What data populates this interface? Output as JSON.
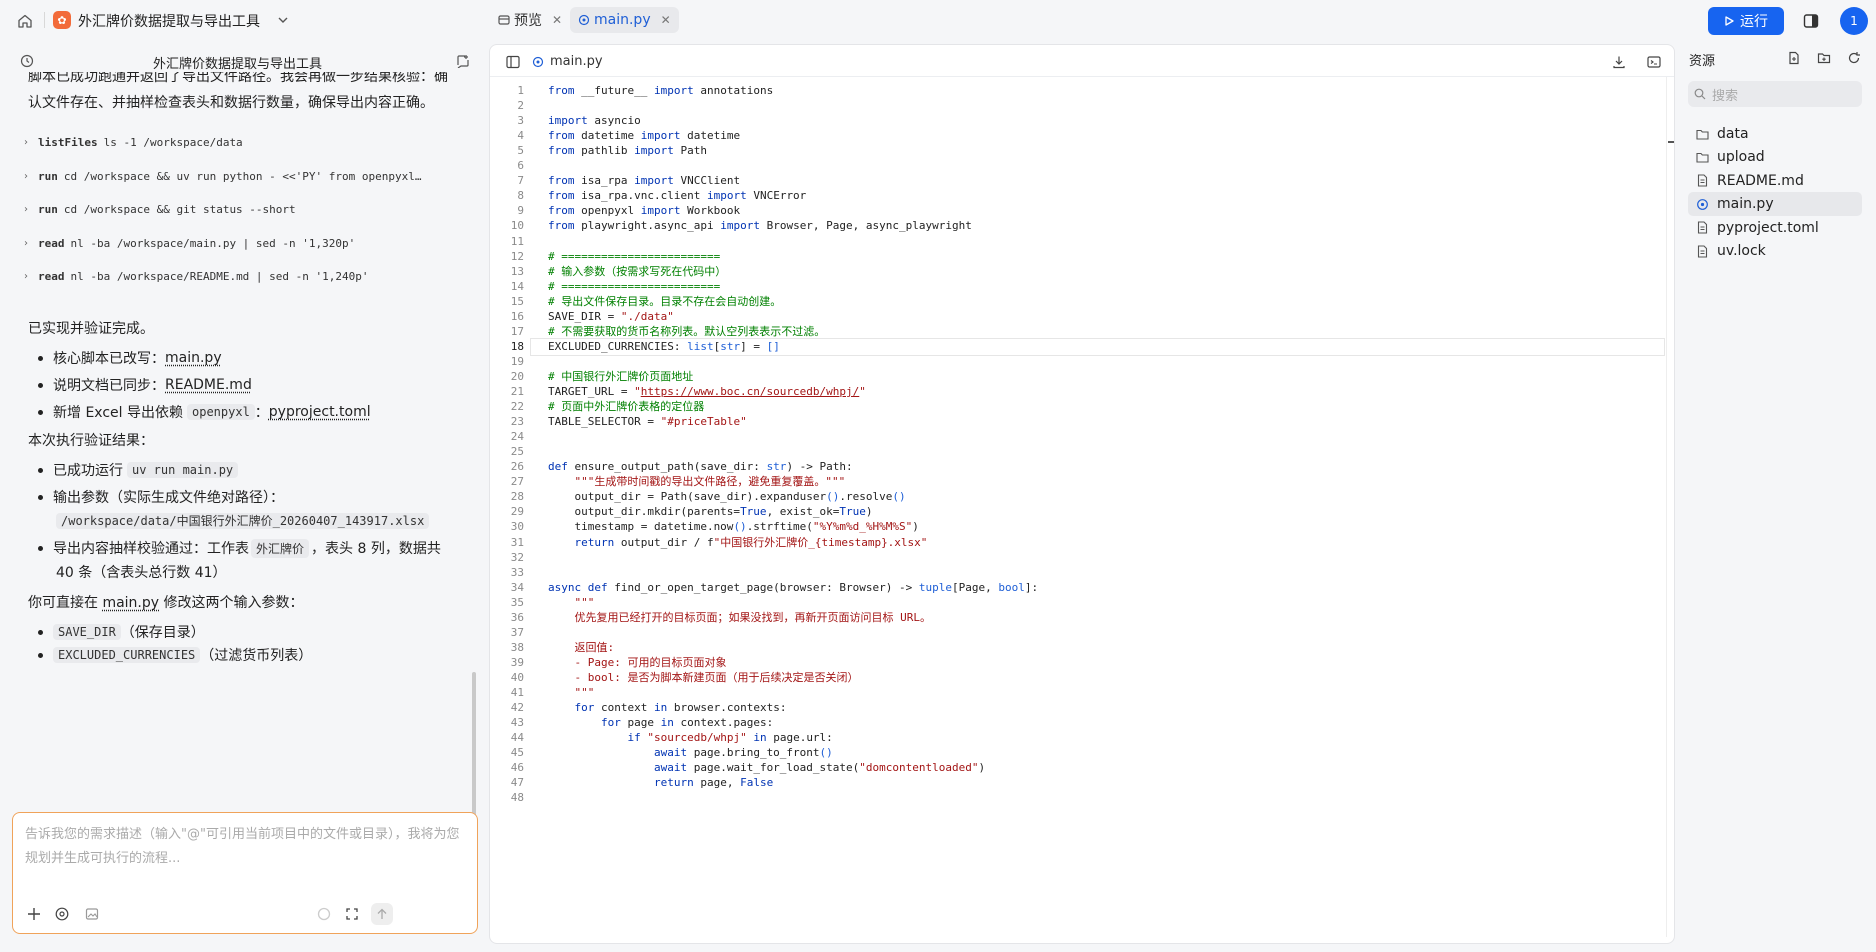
{
  "topbar": {
    "app_logo_text": "✿",
    "app_title": "外汇牌价数据提取与导出工具",
    "tabs": [
      {
        "label": "预览"
      },
      {
        "label": "main.py"
      }
    ],
    "run_label": "运行",
    "avatar_text": "1"
  },
  "chat": {
    "title": "外汇牌价数据提取与导出工具",
    "intro": "脚本已成功跑通并返回了导出文件路径。我会再做一步结果核验：确认文件存在、并抽样检查表头和数据行数量，确保导出内容正确。",
    "tools": [
      {
        "kw": "listFiles",
        "cmd": "ls -1 /workspace/data"
      },
      {
        "kw": "run",
        "cmd": "cd /workspace && uv run python - <<'PY' from openpyxl import load_workbook"
      },
      {
        "kw": "run",
        "cmd": "cd /workspace && git status --short"
      },
      {
        "kw": "read",
        "cmd": "nl -ba /workspace/main.py | sed -n '1,320p'"
      },
      {
        "kw": "read",
        "cmd": "nl -ba /workspace/README.md | sed -n '1,240p'"
      }
    ],
    "done_text": "已实现并验证完成。",
    "items": {
      "core_label": "核心脚本已改写：",
      "core_link": "main.py",
      "doc_label": "说明文档已同步：",
      "doc_link": "README.md",
      "dep_label": "新增 Excel 导出依赖",
      "dep_code": "openpyxl",
      "dep_sep": "：",
      "dep_link": "pyproject.toml"
    },
    "result_title": "本次执行验证结果：",
    "results": {
      "ran_label": "已成功运行",
      "ran_code": "uv run main.py",
      "out_label": "输出参数（实际生成文件绝对路径）：",
      "out_code": "/workspace/data/中国银行外汇牌价_20260407_143917.xlsx",
      "check_pre": "导出内容抽样校验通过：工作表",
      "check_code": "外汇牌价",
      "check_post": "，表头 8 列，数据共",
      "check_post2": "40 条（含表头总行数 41）"
    },
    "modify_pre": "你可直接在",
    "modify_link": "main.py",
    "modify_post": "修改这两个输入参数：",
    "params": [
      {
        "code": "SAVE_DIR",
        "desc": "（保存目录）"
      },
      {
        "code": "EXCLUDED_CURRENCIES",
        "desc": "（过滤货币列表）"
      }
    ],
    "input_placeholder": "告诉我您的需求描述（输入\"@\"可引用当前项目中的文件或目录），我将为您规划并生成可执行的流程..."
  },
  "editor": {
    "filename": "main.py",
    "current_line": 18,
    "lines": [
      [
        [
          "kw",
          "from"
        ],
        [
          "t",
          " __future__ "
        ],
        [
          "kw",
          "import"
        ],
        [
          "t",
          " annotations"
        ]
      ],
      [],
      [
        [
          "kw",
          "import"
        ],
        [
          "t",
          " asyncio"
        ]
      ],
      [
        [
          "kw",
          "from"
        ],
        [
          "t",
          " datetime "
        ],
        [
          "kw",
          "import"
        ],
        [
          "t",
          " datetime"
        ]
      ],
      [
        [
          "kw",
          "from"
        ],
        [
          "t",
          " pathlib "
        ],
        [
          "kw",
          "import"
        ],
        [
          "t",
          " Path"
        ]
      ],
      [],
      [
        [
          "kw",
          "from"
        ],
        [
          "t",
          " isa_rpa "
        ],
        [
          "kw",
          "import"
        ],
        [
          "t",
          " VNCClient"
        ]
      ],
      [
        [
          "kw",
          "from"
        ],
        [
          "t",
          " isa_rpa.vnc.client "
        ],
        [
          "kw",
          "import"
        ],
        [
          "t",
          " VNCError"
        ]
      ],
      [
        [
          "kw",
          "from"
        ],
        [
          "t",
          " openpyxl "
        ],
        [
          "kw",
          "import"
        ],
        [
          "t",
          " Workbook"
        ]
      ],
      [
        [
          "kw",
          "from"
        ],
        [
          "t",
          " playwright.async_api "
        ],
        [
          "kw",
          "import"
        ],
        [
          "t",
          " Browser, Page, async_playwright"
        ]
      ],
      [],
      [
        [
          "cm",
          "# ========================"
        ]
      ],
      [
        [
          "cm",
          "# 输入参数（按需求写死在代码中）"
        ]
      ],
      [
        [
          "cm",
          "# ========================"
        ]
      ],
      [
        [
          "cm",
          "# 导出文件保存目录。目录不存在会自动创建。"
        ]
      ],
      [
        [
          "t",
          "SAVE_DIR = "
        ],
        [
          "st",
          "\"./data\""
        ]
      ],
      [
        [
          "cm",
          "# 不需要获取的货币名称列表。默认空列表表示不过滤。"
        ]
      ],
      [
        [
          "t",
          "EXCLUDED_CURRENCIES: "
        ],
        [
          "bi",
          "list"
        ],
        [
          "t",
          "["
        ],
        [
          "bi",
          "str"
        ],
        [
          "t",
          "] = "
        ],
        [
          "bl",
          "[]"
        ]
      ],
      [],
      [
        [
          "cm",
          "# 中国银行外汇牌价页面地址"
        ]
      ],
      [
        [
          "t",
          "TARGET_URL = "
        ],
        [
          "st",
          "\""
        ],
        [
          "url",
          "https://www.boc.cn/sourcedb/whpj/"
        ],
        [
          "st",
          "\""
        ]
      ],
      [
        [
          "cm",
          "# 页面中外汇牌价表格的定位器"
        ]
      ],
      [
        [
          "t",
          "TABLE_SELECTOR = "
        ],
        [
          "st",
          "\"#priceTable\""
        ]
      ],
      [],
      [],
      [
        [
          "kw",
          "def"
        ],
        [
          "t",
          " ensure_output_path(save_dir: "
        ],
        [
          "bi",
          "str"
        ],
        [
          "t",
          ") -> Path:"
        ]
      ],
      [
        [
          "t",
          "    "
        ],
        [
          "st",
          "\"\"\"生成带时间戳的导出文件路径，避免重复覆盖。\"\"\""
        ]
      ],
      [
        [
          "t",
          "    output_dir = Path(save_dir).expanduser"
        ],
        [
          "bl",
          "()"
        ],
        [
          "t",
          ".resolve"
        ],
        [
          "bl",
          "()"
        ]
      ],
      [
        [
          "t",
          "    output_dir.mkdir(parents="
        ],
        [
          "kw",
          "True"
        ],
        [
          "t",
          ", exist_ok="
        ],
        [
          "kw",
          "True"
        ],
        [
          "t",
          ")"
        ]
      ],
      [
        [
          "t",
          "    timestamp = datetime.now"
        ],
        [
          "bl",
          "()"
        ],
        [
          "t",
          ".strftime("
        ],
        [
          "st",
          "\"%Y%m%d_%H%M%S\""
        ],
        [
          "t",
          ")"
        ]
      ],
      [
        [
          "t",
          "    "
        ],
        [
          "kw",
          "return"
        ],
        [
          "t",
          " output_dir / f"
        ],
        [
          "st",
          "\"中国银行外汇牌价_{timestamp}.xlsx\""
        ]
      ],
      [],
      [],
      [
        [
          "kw",
          "async def"
        ],
        [
          "t",
          " find_or_open_target_page(browser: Browser) -> "
        ],
        [
          "bi",
          "tuple"
        ],
        [
          "t",
          "[Page, "
        ],
        [
          "bi",
          "bool"
        ],
        [
          "t",
          "]:"
        ]
      ],
      [
        [
          "t",
          "    "
        ],
        [
          "st",
          "\"\"\""
        ]
      ],
      [
        [
          "t",
          "    "
        ],
        [
          "st",
          "优先复用已经打开的目标页面；如果没找到，再新开页面访问目标 URL。"
        ]
      ],
      [],
      [
        [
          "t",
          "    "
        ],
        [
          "st",
          "返回值:"
        ]
      ],
      [
        [
          "t",
          "    "
        ],
        [
          "st",
          "- Page: 可用的目标页面对象"
        ]
      ],
      [
        [
          "t",
          "    "
        ],
        [
          "st",
          "- bool: 是否为脚本新建页面（用于后续决定是否关闭）"
        ]
      ],
      [
        [
          "t",
          "    "
        ],
        [
          "st",
          "\"\"\""
        ]
      ],
      [
        [
          "t",
          "    "
        ],
        [
          "kw",
          "for"
        ],
        [
          "t",
          " context "
        ],
        [
          "kw",
          "in"
        ],
        [
          "t",
          " browser.contexts:"
        ]
      ],
      [
        [
          "t",
          "        "
        ],
        [
          "kw",
          "for"
        ],
        [
          "t",
          " page "
        ],
        [
          "kw",
          "in"
        ],
        [
          "t",
          " context.pages:"
        ]
      ],
      [
        [
          "t",
          "            "
        ],
        [
          "kw",
          "if"
        ],
        [
          "t",
          " "
        ],
        [
          "st",
          "\"sourcedb/whpj\""
        ],
        [
          "t",
          " "
        ],
        [
          "kw",
          "in"
        ],
        [
          "t",
          " page.url:"
        ]
      ],
      [
        [
          "t",
          "                "
        ],
        [
          "kw",
          "await"
        ],
        [
          "t",
          " page.bring_to_front"
        ],
        [
          "bl",
          "()"
        ]
      ],
      [
        [
          "t",
          "                "
        ],
        [
          "kw",
          "await"
        ],
        [
          "t",
          " page.wait_for_load_state("
        ],
        [
          "st",
          "\"domcontentloaded\""
        ],
        [
          "t",
          ")"
        ]
      ],
      [
        [
          "t",
          "                "
        ],
        [
          "kw",
          "return"
        ],
        [
          "t",
          " page, "
        ],
        [
          "kw",
          "False"
        ]
      ],
      [
        [
          "t",
          ""
        ]
      ]
    ]
  },
  "resources": {
    "title": "资源",
    "search_placeholder": "搜索",
    "items": [
      {
        "name": "data",
        "type": "folder"
      },
      {
        "name": "upload",
        "type": "folder"
      },
      {
        "name": "README.md",
        "type": "file"
      },
      {
        "name": "main.py",
        "type": "python",
        "selected": true
      },
      {
        "name": "pyproject.toml",
        "type": "file"
      },
      {
        "name": "uv.lock",
        "type": "file"
      }
    ]
  },
  "colors": {
    "accent": "#1764f0",
    "keyword": "#0033b3",
    "string": "#a31515",
    "comment": "#008000",
    "builtin": "#1f5fd6"
  }
}
